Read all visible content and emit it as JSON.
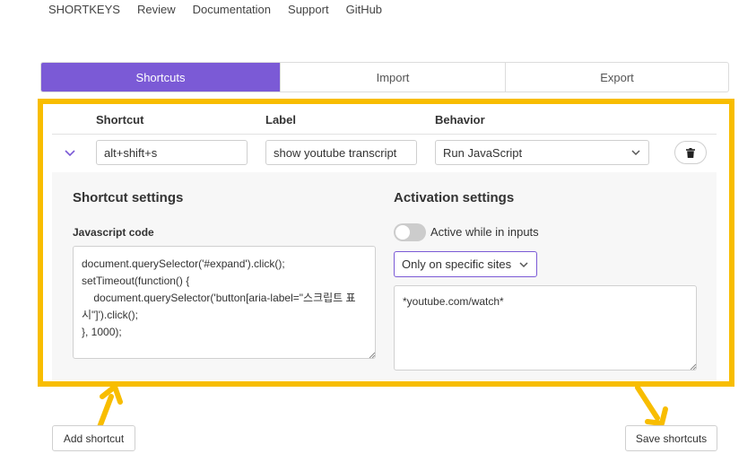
{
  "nav": [
    "SHORTKEYS",
    "Review",
    "Documentation",
    "Support",
    "GitHub"
  ],
  "tabs": {
    "shortcuts": "Shortcuts",
    "import": "Import",
    "export": "Export"
  },
  "table": {
    "headers": {
      "shortcut": "Shortcut",
      "label": "Label",
      "behavior": "Behavior"
    },
    "row": {
      "shortcut": "alt+shift+s",
      "label": "show youtube transcript",
      "behavior": "Run JavaScript"
    }
  },
  "shortcut_settings": {
    "title": "Shortcut settings",
    "code_label": "Javascript code",
    "code": "document.querySelector('#expand').click();\nsetTimeout(function() {\n    document.querySelector('button[aria-label=\"스크립트 표시\"]').click();\n}, 1000);"
  },
  "activation_settings": {
    "title": "Activation settings",
    "toggle_label": "Active while in inputs",
    "sites_mode": "Only on specific sites",
    "sites": "*youtube.com/watch*"
  },
  "buttons": {
    "add": "Add shortcut",
    "save": "Save shortcuts"
  },
  "colors": {
    "accent": "#7b5ad6",
    "highlight": "#f8bd00"
  }
}
